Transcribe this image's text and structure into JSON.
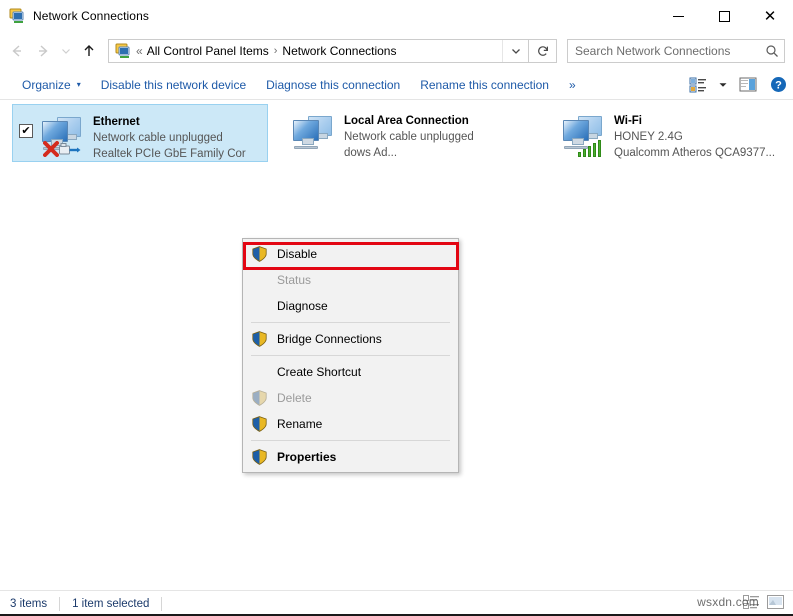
{
  "window": {
    "title": "Network Connections",
    "icon": "network-connections-icon",
    "caption": {
      "minimize": "—",
      "maximize": "☐",
      "close": "✕"
    }
  },
  "navbar": {
    "back_icon": "back-arrow-icon",
    "forward_icon": "forward-arrow-icon",
    "recent_icon": "chevron-down-icon",
    "up_icon": "up-arrow-icon",
    "breadcrumb": {
      "icon": "network-connections-icon",
      "overflow": "«",
      "items": [
        "All Control Panel Items",
        "Network Connections"
      ],
      "separator": "›"
    },
    "dropdown_icon": "chevron-down-icon",
    "refresh_icon": "refresh-icon"
  },
  "search": {
    "placeholder": "Search Network Connections",
    "value": "",
    "icon": "search-icon"
  },
  "toolbar": {
    "organize": "Organize",
    "organize_caret": "▾",
    "disable_device": "Disable this network device",
    "diagnose": "Diagnose this connection",
    "rename": "Rename this connection",
    "overflow": "»",
    "view_icon": "view-layout-icon",
    "view_caret": "▾",
    "preview_pane_icon": "preview-pane-icon",
    "help_icon": "help-icon"
  },
  "connections": [
    {
      "name": "Ethernet",
      "status": "Network cable unplugged",
      "adapter": "Realtek PCIe GbE Family Cor",
      "selected": true,
      "checked": true,
      "check_glyph": "✔",
      "icon": "network-adapter-disconnected-icon"
    },
    {
      "name": "Local Area Connection",
      "status": "Network cable unplugged",
      "adapter": "dows Ad...",
      "selected": false,
      "checked": false,
      "check_glyph": "",
      "icon": "network-adapter-icon"
    },
    {
      "name": "Wi-Fi",
      "status": "HONEY 2.4G",
      "adapter": "Qualcomm Atheros QCA9377...",
      "selected": false,
      "checked": false,
      "check_glyph": "",
      "icon": "wireless-adapter-icon"
    }
  ],
  "context_menu": {
    "items": [
      {
        "label": "Disable",
        "shield": true,
        "disabled": false,
        "bold": false,
        "highlighted": true
      },
      {
        "label": "Status",
        "shield": false,
        "disabled": true,
        "bold": false,
        "highlighted": false
      },
      {
        "label": "Diagnose",
        "shield": false,
        "disabled": false,
        "bold": false,
        "highlighted": false
      },
      {
        "label": "Bridge Connections",
        "shield": true,
        "disabled": false,
        "bold": false,
        "highlighted": false
      },
      {
        "label": "Create Shortcut",
        "shield": false,
        "disabled": false,
        "bold": false,
        "highlighted": false
      },
      {
        "label": "Delete",
        "shield": true,
        "disabled": true,
        "bold": false,
        "highlighted": false
      },
      {
        "label": "Rename",
        "shield": true,
        "disabled": false,
        "bold": false,
        "highlighted": false
      },
      {
        "label": "Properties",
        "shield": true,
        "disabled": false,
        "bold": true,
        "highlighted": false
      }
    ],
    "highlight_color": "#e30613"
  },
  "statusbar": {
    "item_count": "3 items",
    "selection": "1 item selected",
    "details_view_icon": "details-view-icon",
    "large_icons_view_icon": "large-icons-view-icon",
    "watermark": "wsxdn.com"
  },
  "colors": {
    "link": "#1e5aa8",
    "selection_fill": "#cce8f7",
    "selection_border": "#99d1f0",
    "highlight": "#e30613"
  }
}
